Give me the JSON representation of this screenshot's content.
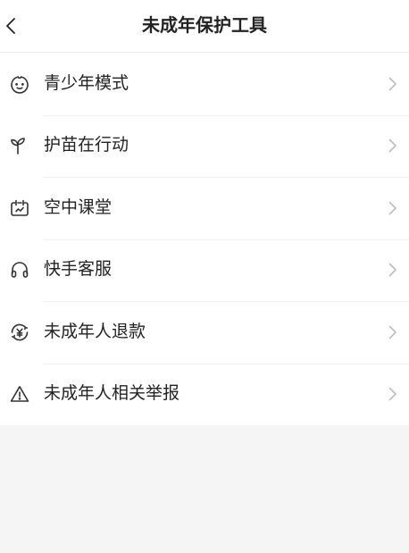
{
  "header": {
    "title": "未成年保护工具",
    "back_icon": "chevron-left-icon"
  },
  "menu": {
    "items": [
      {
        "label": "青少年模式",
        "icon": "child-face-icon"
      },
      {
        "label": "护苗在行动",
        "icon": "sprout-icon"
      },
      {
        "label": "空中课堂",
        "icon": "online-class-icon"
      },
      {
        "label": "快手客服",
        "icon": "headset-icon"
      },
      {
        "label": "未成年人退款",
        "icon": "yuan-refund-icon"
      },
      {
        "label": "未成年人相关举报",
        "icon": "warning-icon"
      }
    ],
    "row_chevron_icon": "chevron-right-icon"
  },
  "colors": {
    "text": "#222222",
    "icon": "#333333",
    "chevron": "#bdbdbd",
    "divider": "#efefef",
    "background": "#f5f5f5"
  }
}
